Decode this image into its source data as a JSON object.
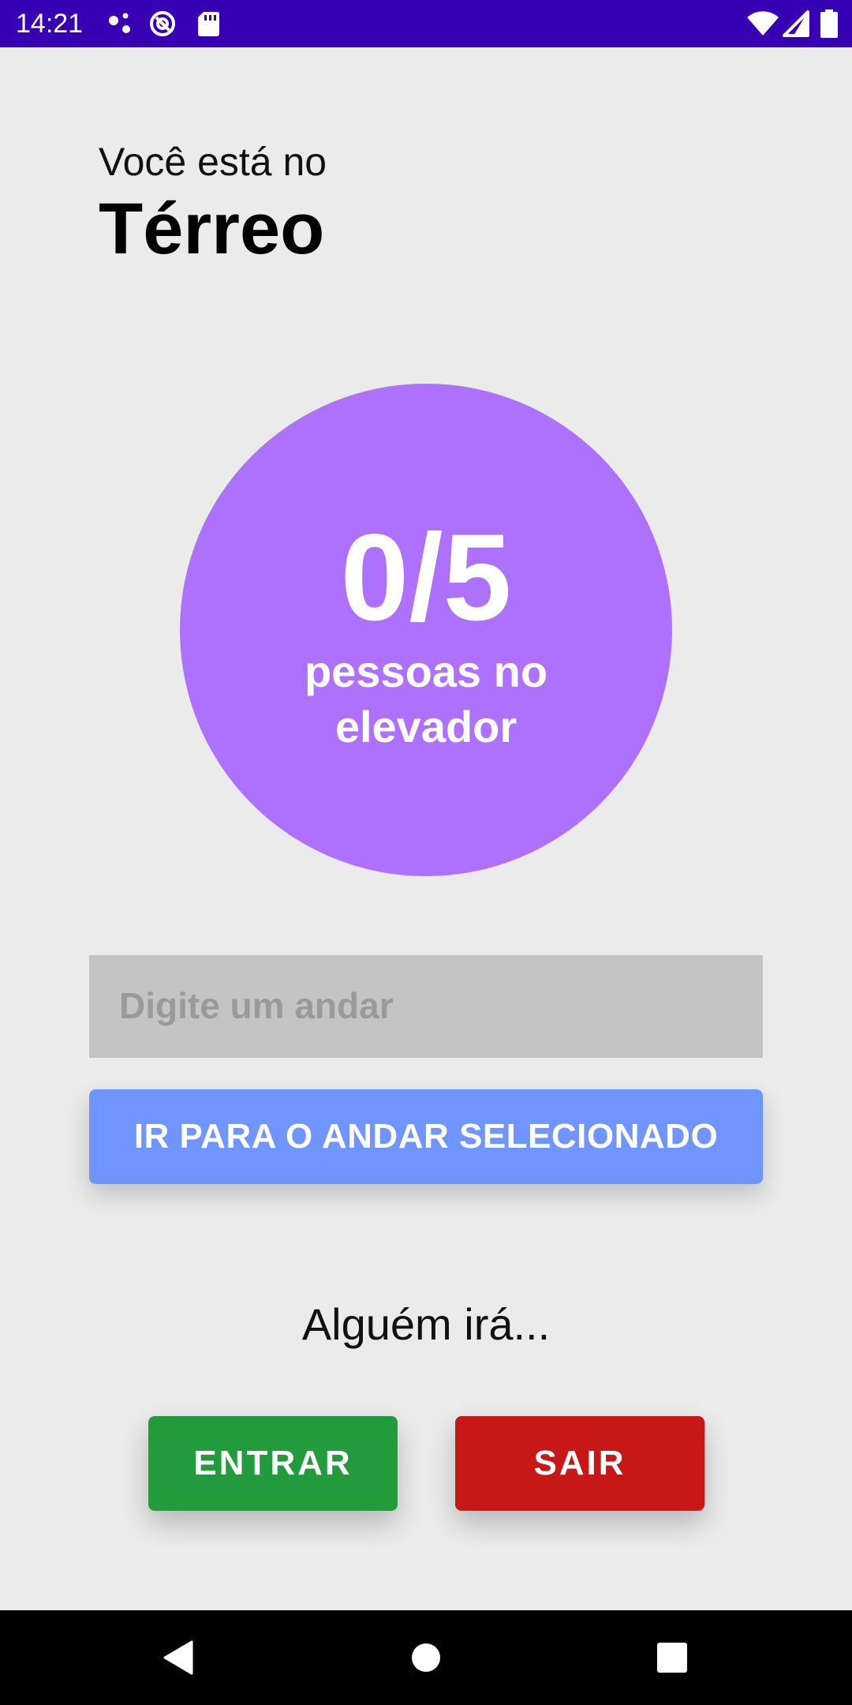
{
  "status_bar": {
    "time": "14:21",
    "left_icons": [
      "assistant-dots-icon",
      "at-sign-icon",
      "sd-card-icon"
    ],
    "right_icons": [
      "wifi-icon",
      "signal-icon",
      "battery-icon"
    ],
    "background_color": "#3700b3"
  },
  "header": {
    "prefix": "Você está no",
    "floor": "Térreo"
  },
  "occupancy": {
    "count": "0/5",
    "label": "pessoas no elevador",
    "color": "#ae71fe"
  },
  "floor_input": {
    "value": "",
    "placeholder": "Digite um andar"
  },
  "go_button": {
    "label": "IR PARA O ANDAR SELECIONADO",
    "color": "#7195ff"
  },
  "someone_text": "Alguém irá...",
  "actions": {
    "enter_label": "ENTRAR",
    "enter_color": "#229b3d",
    "exit_label": "SAIR",
    "exit_color": "#c81717"
  },
  "nav_bar": {
    "icons": [
      "back-icon",
      "home-icon",
      "recents-icon"
    ]
  }
}
